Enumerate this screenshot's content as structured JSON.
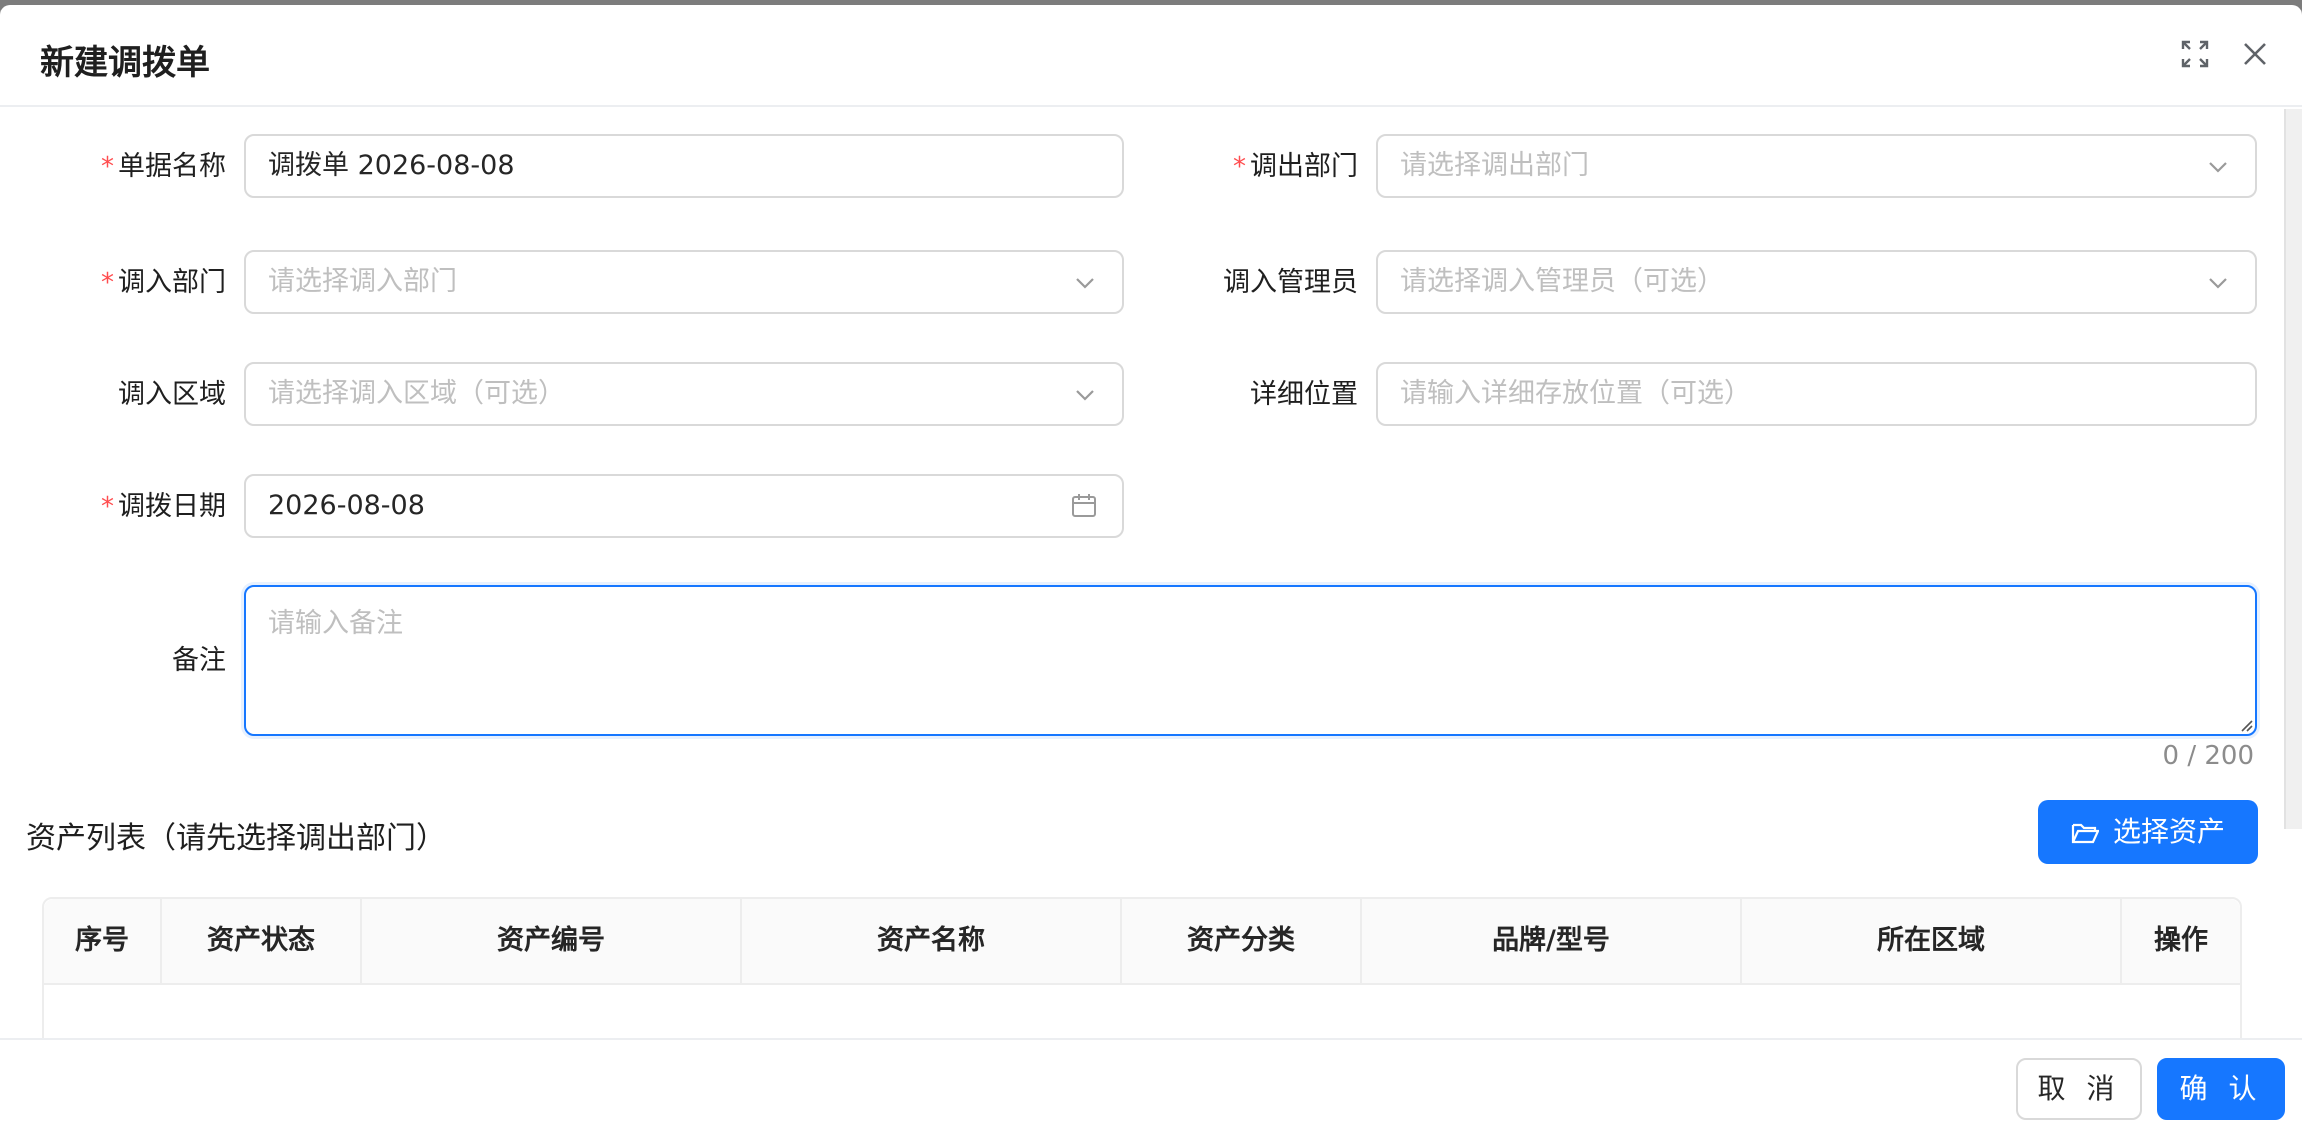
{
  "modal": {
    "title": "新建调拨单",
    "fullscreen_icon": "expand-icon",
    "close_icon": "close-icon"
  },
  "form": {
    "doc_name": {
      "label": "单据名称",
      "required": true,
      "value": "调拨单 2026-08-08"
    },
    "out_dept": {
      "label": "调出部门",
      "required": true,
      "placeholder": "请选择调出部门"
    },
    "in_dept": {
      "label": "调入部门",
      "required": true,
      "placeholder": "请选择调入部门"
    },
    "in_admin": {
      "label": "调入管理员",
      "required": false,
      "placeholder": "请选择调入管理员（可选）"
    },
    "in_area": {
      "label": "调入区域",
      "required": false,
      "placeholder": "请选择调入区域（可选）"
    },
    "location": {
      "label": "详细位置",
      "required": false,
      "placeholder": "请输入详细存放位置（可选）"
    },
    "date": {
      "label": "调拨日期",
      "required": true,
      "value": "2026-08-08"
    },
    "remark": {
      "label": "备注",
      "placeholder": "请输入备注",
      "counter": "0 / 200"
    },
    "required_mark": "*"
  },
  "assets": {
    "title": "资产列表（请先选择调出部门）",
    "select_button": "选择资产",
    "columns": [
      "序号",
      "资产状态",
      "资产编号",
      "资产名称",
      "资产分类",
      "品牌/型号",
      "所在区域",
      "操作"
    ]
  },
  "footer": {
    "cancel": "取 消",
    "confirm": "确 认"
  },
  "colors": {
    "primary": "#1677ff",
    "required": "#ff4d4f",
    "placeholder": "#bfbfbf"
  }
}
